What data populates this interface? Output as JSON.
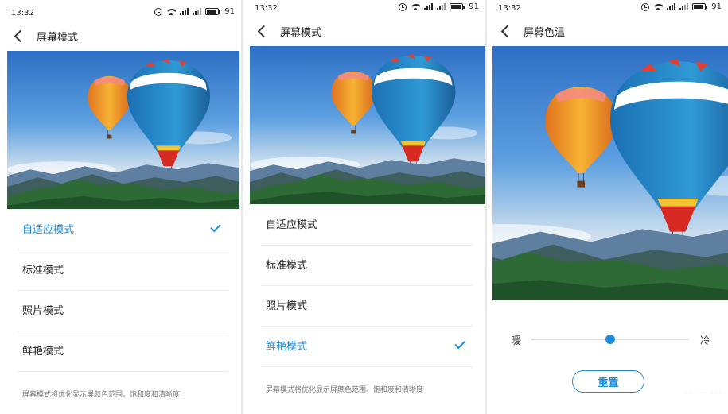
{
  "status_bar": {
    "time": "13:32",
    "battery": "91"
  },
  "mode_screen": {
    "title": "屏幕模式",
    "options": [
      "自适应模式",
      "标准模式",
      "照片模式",
      "鲜艳模式"
    ],
    "note": "屏幕模式将优化显示屏颜色范围、饱和度和清晰度"
  },
  "screen_1": {
    "selected_option": "自适应模式"
  },
  "screen_2": {
    "selected_option": "鲜艳模式"
  },
  "color_temp_screen": {
    "title": "屏幕色温",
    "warm_label": "暖",
    "cold_label": "冷",
    "slider_value_percent": 50,
    "reset_label": "重置"
  },
  "colors": {
    "accent": "#1e8bdc",
    "sky_top": "#2d6fc4",
    "sky_bottom": "#f4e6d2",
    "mountain": "#2e6a35"
  },
  "icons": [
    "alarm-icon",
    "wifi-icon",
    "signal-icon",
    "battery-icon",
    "back-arrow-icon",
    "checkmark-icon"
  ]
}
